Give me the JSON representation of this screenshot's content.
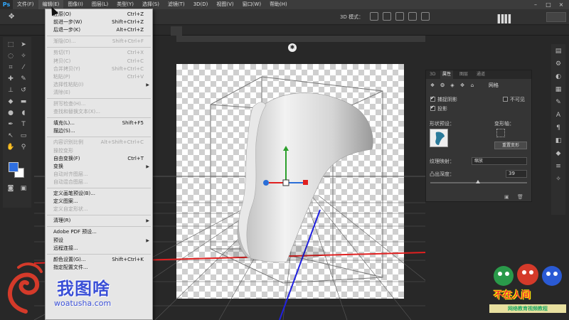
{
  "app": {
    "logo": "Ps"
  },
  "menubar": {
    "items": [
      "文件(F)",
      "编辑(E)",
      "图像(I)",
      "图层(L)",
      "类型(Y)",
      "选择(S)",
      "滤镜(T)",
      "3D(D)",
      "视图(V)",
      "窗口(W)",
      "帮助(H)"
    ],
    "active_index": 1,
    "window_controls": [
      "–",
      "□",
      "×"
    ]
  },
  "optionsbar": {
    "mode_label": "3D 模式："
  },
  "edit_menu": {
    "items": [
      {
        "label": "还原(O)",
        "shortcut": "Ctrl+Z",
        "enabled": true,
        "submenu": false
      },
      {
        "label": "前进一步(W)",
        "shortcut": "Shift+Ctrl+Z",
        "enabled": true,
        "submenu": false
      },
      {
        "label": "后退一步(K)",
        "shortcut": "Alt+Ctrl+Z",
        "enabled": true,
        "submenu": false
      },
      {
        "sep": true
      },
      {
        "label": "渐隐(D)...",
        "shortcut": "Shift+Ctrl+F",
        "enabled": false,
        "submenu": false
      },
      {
        "sep": true
      },
      {
        "label": "剪切(T)",
        "shortcut": "Ctrl+X",
        "enabled": false,
        "submenu": false
      },
      {
        "label": "拷贝(C)",
        "shortcut": "Ctrl+C",
        "enabled": false,
        "submenu": false
      },
      {
        "label": "合并拷贝(Y)",
        "shortcut": "Shift+Ctrl+C",
        "enabled": false,
        "submenu": false
      },
      {
        "label": "粘贴(P)",
        "shortcut": "Ctrl+V",
        "enabled": false,
        "submenu": false
      },
      {
        "label": "选择性粘贴(I)",
        "shortcut": "",
        "enabled": false,
        "submenu": true
      },
      {
        "label": "清除(E)",
        "shortcut": "",
        "enabled": false,
        "submenu": false
      },
      {
        "sep": true
      },
      {
        "label": "拼写检查(H)...",
        "shortcut": "",
        "enabled": false,
        "submenu": false
      },
      {
        "label": "查找和替换文本(X)...",
        "shortcut": "",
        "enabled": false,
        "submenu": false
      },
      {
        "sep": true
      },
      {
        "label": "填充(L)...",
        "shortcut": "Shift+F5",
        "enabled": true,
        "submenu": false
      },
      {
        "label": "描边(S)...",
        "shortcut": "",
        "enabled": true,
        "submenu": false
      },
      {
        "sep": true
      },
      {
        "label": "内容识别比例",
        "shortcut": "Alt+Shift+Ctrl+C",
        "enabled": false,
        "submenu": false
      },
      {
        "label": "操控变形",
        "shortcut": "",
        "enabled": false,
        "submenu": false
      },
      {
        "label": "自由变换(F)",
        "shortcut": "Ctrl+T",
        "enabled": true,
        "submenu": false
      },
      {
        "label": "变换",
        "shortcut": "",
        "enabled": true,
        "submenu": true
      },
      {
        "label": "自动对齐图层...",
        "shortcut": "",
        "enabled": false,
        "submenu": false
      },
      {
        "label": "自动混合图层...",
        "shortcut": "",
        "enabled": false,
        "submenu": false
      },
      {
        "sep": true
      },
      {
        "label": "定义画笔预设(B)...",
        "shortcut": "",
        "enabled": true,
        "submenu": false
      },
      {
        "label": "定义图案...",
        "shortcut": "",
        "enabled": true,
        "submenu": false
      },
      {
        "label": "定义自定形状...",
        "shortcut": "",
        "enabled": false,
        "submenu": false
      },
      {
        "sep": true
      },
      {
        "label": "清理(R)",
        "shortcut": "",
        "enabled": true,
        "submenu": true
      },
      {
        "sep": true
      },
      {
        "label": "Adobe PDF 预设...",
        "shortcut": "",
        "enabled": true,
        "submenu": false
      },
      {
        "label": "预设",
        "shortcut": "",
        "enabled": true,
        "submenu": true
      },
      {
        "label": "远程连接...",
        "shortcut": "",
        "enabled": true,
        "submenu": false
      },
      {
        "sep": true
      },
      {
        "label": "颜色设置(G)...",
        "shortcut": "Shift+Ctrl+K",
        "enabled": true,
        "submenu": false
      },
      {
        "label": "指定配置文件...",
        "shortcut": "",
        "enabled": true,
        "submenu": false
      }
    ]
  },
  "properties_panel": {
    "tabs": [
      "3D",
      "属性",
      "图层",
      "通道"
    ],
    "active_tab": 1,
    "mesh_label": "网格",
    "catch_shadows_label": "捕捉阴影",
    "catch_shadows": true,
    "invisible_label": "不可见",
    "invisible": false,
    "cast_shadows_label": "投影",
    "cast_shadows": true,
    "shape_preset_label": "形状预设：",
    "deform_axis_label": "变形轴：",
    "reset_deform_label": "重置变形",
    "texture_mapping_label": "纹理映射：",
    "texture_mapping_value": "缩放",
    "extrusion_depth_label": "凸出深度：",
    "extrusion_depth_value": "39"
  },
  "watermarks": {
    "left_title": "我图啥",
    "left_url": "woatusha.com",
    "right_title": "不在人间",
    "right_sub": "网络教育视频教程"
  }
}
